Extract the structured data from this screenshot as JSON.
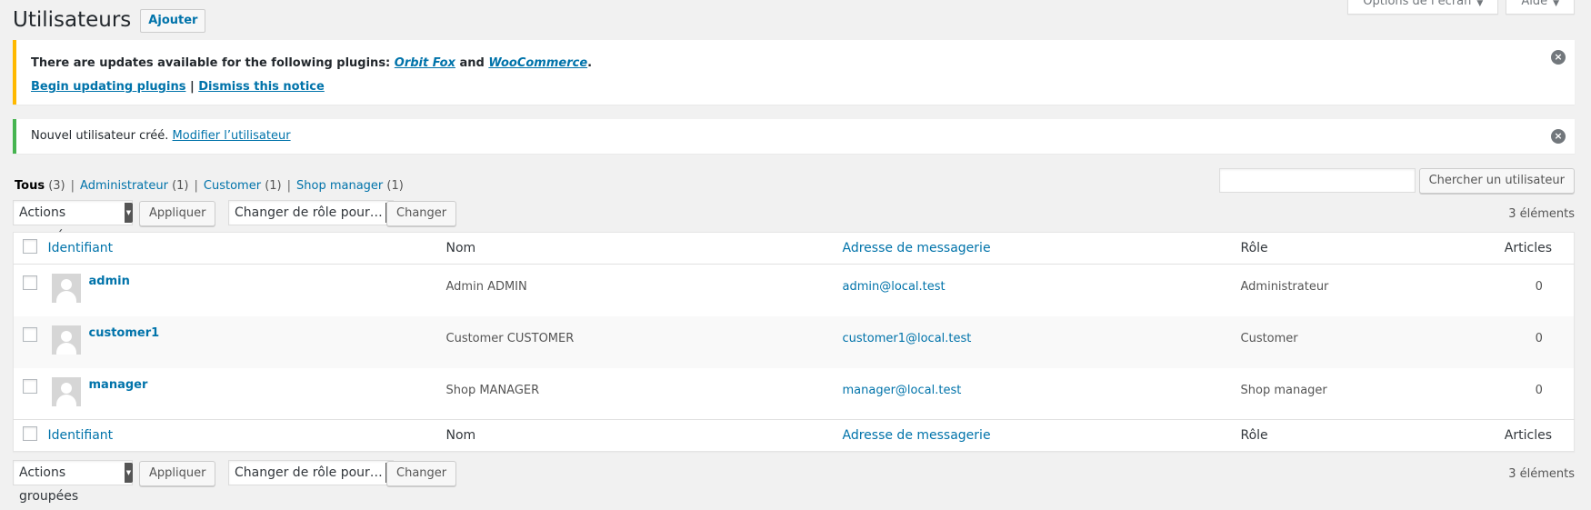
{
  "screen_meta": {
    "options_label": "Options de l’écran",
    "help_label": "Aide"
  },
  "header": {
    "title": "Utilisateurs",
    "add_label": "Ajouter"
  },
  "notices": {
    "update": {
      "prefix": "There are updates available for the following plugins: ",
      "plugin1": "Orbit Fox",
      "and": " and ",
      "plugin2": "WooCommerce",
      "period": ".",
      "begin_link": "Begin updating plugins",
      "sep": " | ",
      "dismiss_link": "Dismiss this notice"
    },
    "created": {
      "text": "Nouvel utilisateur créé. ",
      "link": "Modifier l’utilisateur"
    }
  },
  "views": [
    {
      "label": "Tous",
      "count": "(3)"
    },
    {
      "label": "Administrateur",
      "count": "(1)"
    },
    {
      "label": "Customer",
      "count": "(1)"
    },
    {
      "label": "Shop manager",
      "count": "(1)"
    }
  ],
  "views_sep": "|",
  "search": {
    "button_label": "Chercher un utilisateur",
    "value": ""
  },
  "tablenav": {
    "bulk_label": "Actions groupées",
    "apply_label": "Appliquer",
    "role_label": "Changer de rôle pour…",
    "change_label": "Changer",
    "count_label": "3 éléments"
  },
  "table": {
    "columns": {
      "username": "Identifiant",
      "name": "Nom",
      "email": "Adresse de messagerie",
      "role": "Rôle",
      "posts": "Articles"
    },
    "rows": [
      {
        "username": "admin",
        "name": "Admin ADMIN",
        "email": "admin@local.test",
        "role": "Administrateur",
        "posts": "0"
      },
      {
        "username": "customer1",
        "name": "Customer CUSTOMER",
        "email": "customer1@local.test",
        "role": "Customer",
        "posts": "0"
      },
      {
        "username": "manager",
        "name": "Shop MANAGER",
        "email": "manager@local.test",
        "role": "Shop manager",
        "posts": "0"
      }
    ]
  },
  "colors": {
    "link": "#0073aa",
    "warning": "#ffb900",
    "success": "#46b450",
    "background": "#f1f1f1"
  },
  "icons": {
    "dismiss": "close-circle-icon",
    "avatar": "default-avatar-icon",
    "dropdown": "chevron-down-icon"
  }
}
